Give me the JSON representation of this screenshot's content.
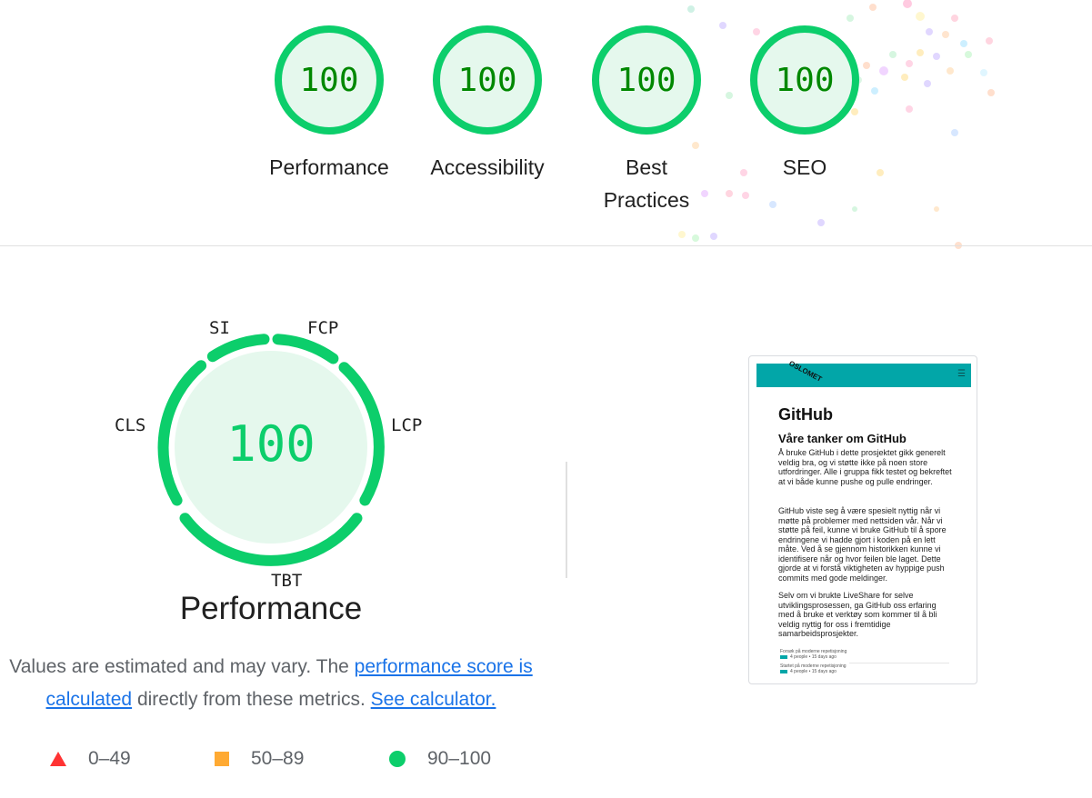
{
  "colors": {
    "pass": "#0cce6b",
    "pass_text": "#008800",
    "average": "#ffaa33",
    "fail": "#ff3333",
    "link": "#1a73e8"
  },
  "gauges": [
    {
      "score": "100",
      "label": "Performance"
    },
    {
      "score": "100",
      "label": "Accessibility"
    },
    {
      "score": "100",
      "label": "Best Practices"
    },
    {
      "score": "100",
      "label": "SEO"
    }
  ],
  "performance": {
    "score": "100",
    "title": "Performance",
    "metrics": {
      "si": "SI",
      "fcp": "FCP",
      "lcp": "LCP",
      "tbt": "TBT",
      "cls": "CLS"
    },
    "description": {
      "prefix": "Values are estimated and may vary. The ",
      "link1": "performance score is calculated",
      "middle": " directly from these metrics. ",
      "link2": "See calculator."
    }
  },
  "legend": [
    {
      "shape": "triangle",
      "range": "0–49"
    },
    {
      "shape": "square",
      "range": "50–89"
    },
    {
      "shape": "circle",
      "range": "90–100"
    }
  ],
  "screenshot": {
    "logo_text": "OSLOMET",
    "menu_icon": "hamburger-icon",
    "heading": "GitHub",
    "subheading": "Våre tanker om GitHub",
    "paragraphs": [
      "Å bruke GitHub i dette prosjektet gikk generelt veldig bra, og vi støtte ikke på noen store utfordringer. Alle i gruppa fikk testet og bekreftet at vi både kunne pushe og pulle endringer.",
      "GitHub viste seg å være spesielt nyttig når vi møtte på problemer med nettsiden vår. Når vi støtte på feil, kunne vi bruke GitHub til å spore endringene vi hadde gjort i koden på en lett måte. Ved å se gjennom historikken kunne vi identifisere når og hvor feilen ble laget. Dette gjorde at vi forstå viktigheten av hyppige push commits med gode meldinger.",
      "Selv om vi brukte LiveShare for selve utviklingsprosessen, ga GitHub oss erfaring med å bruke et verktøy som kommer til å bli veldig nyttig for oss i fremtidige samarbeidsprosjekter."
    ],
    "footer_items": [
      {
        "title": "Forsøk på moderne repetisjoning",
        "meta": "4 people • 15 days ago"
      },
      {
        "title": "Startet på moderne repetisjoning",
        "meta": "4 people • 15 days ago"
      }
    ]
  }
}
